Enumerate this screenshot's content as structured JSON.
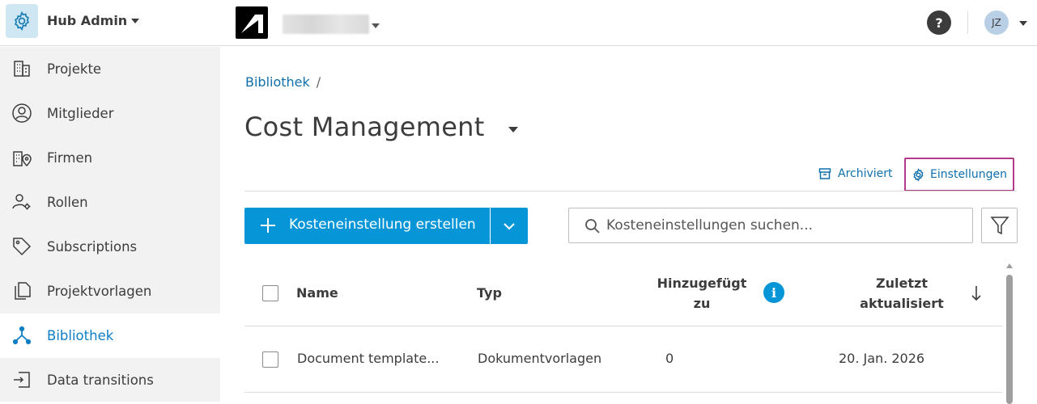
{
  "header": {
    "hub_name": "Hub Admin",
    "help_label": "?",
    "user_initials": "JZ"
  },
  "sidebar": {
    "items": [
      {
        "label": "Projekte",
        "icon": "building-icon",
        "active": false
      },
      {
        "label": "Mitglieder",
        "icon": "person-circle-icon",
        "active": false
      },
      {
        "label": "Firmen",
        "icon": "company-location-icon",
        "active": false
      },
      {
        "label": "Rollen",
        "icon": "person-gear-icon",
        "active": false
      },
      {
        "label": "Subscriptions",
        "icon": "tag-icon",
        "active": false
      },
      {
        "label": "Projektvorlagen",
        "icon": "template-copy-icon",
        "active": false
      },
      {
        "label": "Bibliothek",
        "icon": "library-nodes-icon",
        "active": true
      },
      {
        "label": "Data transitions",
        "icon": "transition-icon",
        "active": false
      }
    ]
  },
  "breadcrumb": {
    "items": [
      "Bibliothek"
    ],
    "separator": "/"
  },
  "page": {
    "title": "Cost Management"
  },
  "actions": {
    "archived_label": "Archiviert",
    "settings_label": "Einstellungen",
    "create_label": "Kosteneinstellung erstellen",
    "search_placeholder": "Kosteneinstellungen suchen..."
  },
  "table": {
    "columns": {
      "name": "Name",
      "type": "Typ",
      "added_line1": "Hinzugefügt",
      "added_line2": "zu",
      "updated_line1": "Zuletzt",
      "updated_line2": "aktualisiert"
    },
    "rows": [
      {
        "name": "Document template...",
        "type": "Dokumentvorlagen",
        "added": "0",
        "updated": "20. Jan. 2026"
      }
    ]
  },
  "colors": {
    "accent_blue": "#0696d7",
    "link_blue": "#0f6fab",
    "highlight_magenta": "#b23a8a",
    "sidebar_bg": "#f2f2f2"
  }
}
